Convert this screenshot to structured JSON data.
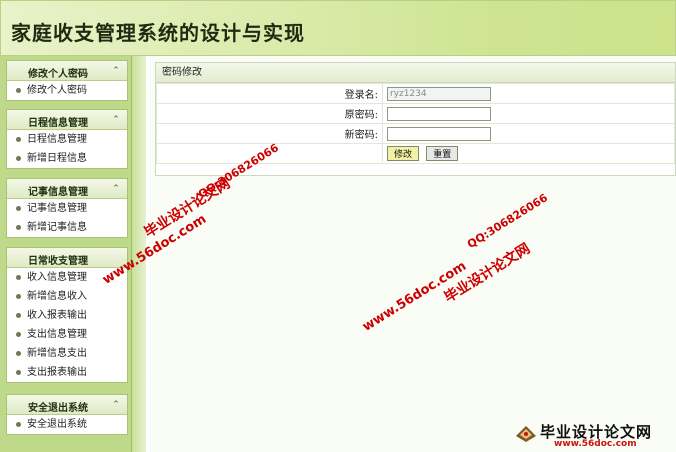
{
  "app": {
    "title": "家庭收支管理系统的设计与实现"
  },
  "sidebar": {
    "groups": [
      {
        "title": "修改个人密码",
        "items": [
          "修改个人密码"
        ]
      },
      {
        "title": "日程信息管理",
        "items": [
          "日程信息管理",
          "新增日程信息"
        ]
      },
      {
        "title": "记事信息管理",
        "items": [
          "记事信息管理",
          "新增记事信息"
        ]
      },
      {
        "title": "日常收支管理",
        "items": [
          "收入信息管理",
          "新增信息收入",
          "收入报表输出",
          "支出信息管理",
          "新增信息支出",
          "支出报表输出"
        ]
      },
      {
        "title": "安全退出系统",
        "items": [
          "安全退出系统"
        ]
      }
    ],
    "collapse_symbol": "«"
  },
  "panel": {
    "title": "密码修改",
    "fields": [
      {
        "label": "登录名:",
        "value": "ryz1234"
      },
      {
        "label": "原密码:",
        "value": ""
      },
      {
        "label": "新密码:",
        "value": ""
      }
    ],
    "submit_label": "修改",
    "reset_label": "重置"
  },
  "watermarks": {
    "text_cn": "毕业设计论文网",
    "site": "www.56doc.com",
    "qq": "QQ:306826066"
  },
  "logo": {
    "text": "毕业设计论文网",
    "url": "www.56doc.com"
  },
  "colors": {
    "accent": "#c9e08c",
    "sidebar": "#bfd98a",
    "watermark": "#cc0000"
  }
}
